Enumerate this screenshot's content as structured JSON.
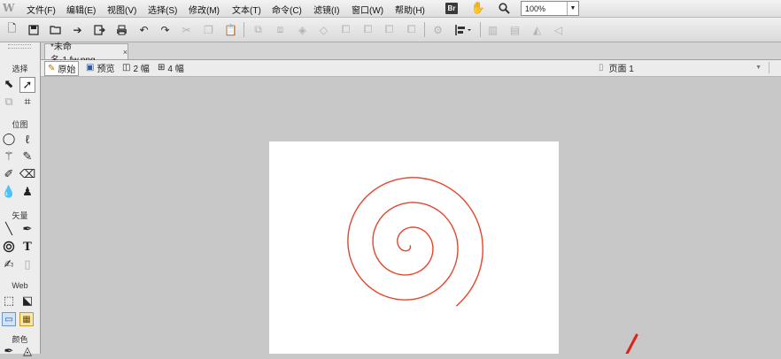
{
  "menubar": {
    "app_logo": "W",
    "items": [
      "文件(F)",
      "编辑(E)",
      "视图(V)",
      "选择(S)",
      "修改(M)",
      "文本(T)",
      "命令(C)",
      "滤镜(I)",
      "窗口(W)",
      "帮助(H)"
    ],
    "bridge_label": "Br",
    "zoom": "100%"
  },
  "toolbar": {
    "buttons": [
      "new-icon",
      "save-icon",
      "open-icon",
      "import-icon",
      "export-icon",
      "print-icon",
      "undo-icon",
      "redo-icon",
      "cut-icon",
      "copy-icon",
      "paste-icon",
      "group-icon",
      "ungroup-icon",
      "join-icon",
      "split-icon",
      "bring-forward-icon",
      "send-backward-icon",
      "bring-to-front-icon",
      "send-to-back-icon",
      "align-icon",
      "distribute-icon",
      "rotate-icon",
      "flip-horizontal-icon",
      "flip-vertical-icon",
      "skew-icon"
    ]
  },
  "tools": {
    "sections": {
      "select": "选择",
      "bitmap": "位图",
      "vector": "矢量",
      "web": "Web",
      "colors": "颜色"
    }
  },
  "document": {
    "tab_title": "*未命名-1.fw.png",
    "tab_close": "×"
  },
  "viewbar": {
    "original": "原始",
    "preview": "预览",
    "two_up": "2 幅",
    "four_up": "4 幅",
    "page": "页面 1"
  },
  "colors": {
    "spiral_stroke": "#e8442c",
    "arrow": "#e0201a",
    "canvas_bg": "#ffffff",
    "workspace_bg": "#c8c8c8"
  }
}
